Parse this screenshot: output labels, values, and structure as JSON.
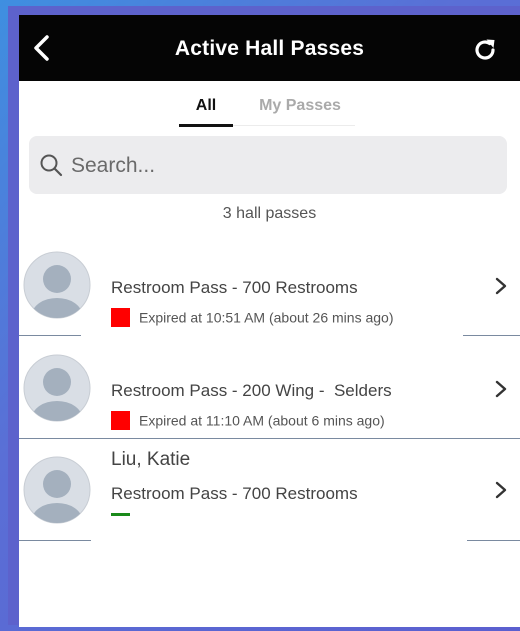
{
  "header": {
    "title": "Active Hall Passes"
  },
  "tabs": [
    {
      "label": "All",
      "active": true
    },
    {
      "label": "My Passes",
      "active": false
    }
  ],
  "search": {
    "placeholder": "Search..."
  },
  "count_text": "3 hall passes",
  "passes": [
    {
      "name": "",
      "pass": "Restroom Pass - 700 Restrooms",
      "status": "Expired at 10:51 AM (about 26 mins ago)",
      "status_color": "#ff0000"
    },
    {
      "name": "",
      "pass": "Restroom Pass - 200 Wing -  Selders",
      "status": "Expired at 11:10 AM (about 6 mins ago)",
      "status_color": "#ff0000"
    },
    {
      "name": "Liu, Katie",
      "pass": "Restroom Pass - 700 Restrooms",
      "status": "",
      "status_color": "#1a8a1a"
    }
  ],
  "colors": {
    "header_bg": "#050505",
    "frame": "#5d62cc",
    "expired": "#ff0000",
    "active": "#1a8a1a"
  }
}
